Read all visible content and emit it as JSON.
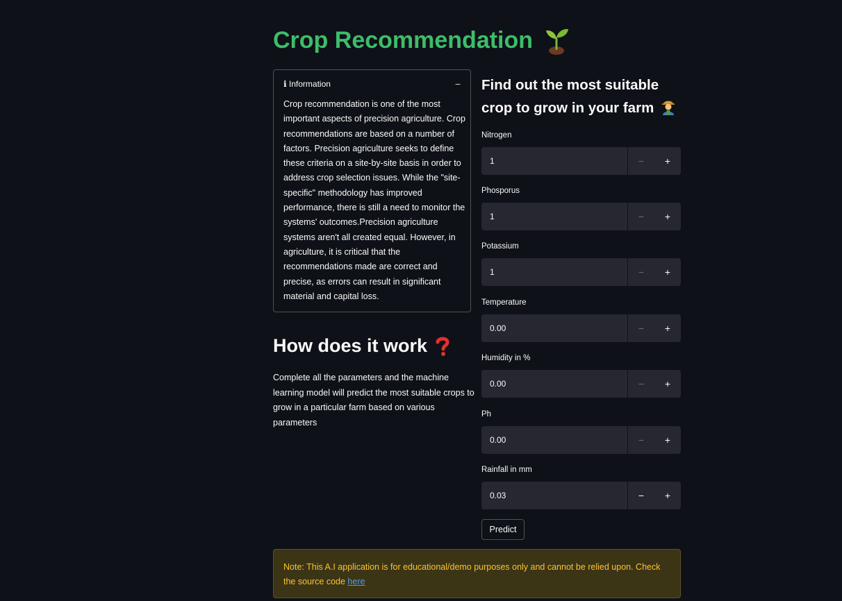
{
  "title": {
    "text": "Crop Recommendation",
    "icon": "seedling-icon"
  },
  "info": {
    "header_icon": "info-icon",
    "header_label": "ℹ Information",
    "collapse_symbol": "−",
    "body": "Crop recommendation is one of the most important aspects of precision agriculture. Crop recommendations are based on a number of factors. Precision agriculture seeks to define these criteria on a site-by-site basis in order to address crop selection issues. While the \"site-specific\" methodology has improved performance, there is still a need to monitor the systems' outcomes.Precision agriculture systems aren't all created equal. However, in agriculture, it is critical that the recommendations made are correct and precise, as errors can result in significant material and capital loss."
  },
  "how": {
    "title": "How does it work",
    "icon": "question-mark-icon",
    "body": "Complete all the parameters and the machine learning model will predict the most suitable crops to grow in a particular farm based on various parameters"
  },
  "form": {
    "title": "Find out the most suitable crop to grow in your farm",
    "icon": "farmer-icon",
    "fields": [
      {
        "label": "Nitrogen",
        "value": "1"
      },
      {
        "label": "Phosporus",
        "value": "1"
      },
      {
        "label": "Potassium",
        "value": "1"
      },
      {
        "label": "Temperature",
        "value": "0.00"
      },
      {
        "label": "Humidity in %",
        "value": "0.00"
      },
      {
        "label": "Ph",
        "value": "0.00"
      },
      {
        "label": "Rainfall in mm",
        "value": "0.03"
      }
    ],
    "minus": "−",
    "plus": "+",
    "predict_label": "Predict"
  },
  "note": {
    "text": "Note: This A.I application is for educational/demo purposes only and cannot be relied upon. Check the source code ",
    "link_text": "here"
  },
  "colors": {
    "background": "#0e1117",
    "title_green": "#3dbd6a",
    "input_bg": "#262730",
    "warning_bg": "#3b3516",
    "warning_text": "#ffc130",
    "link": "#4b9bff"
  }
}
